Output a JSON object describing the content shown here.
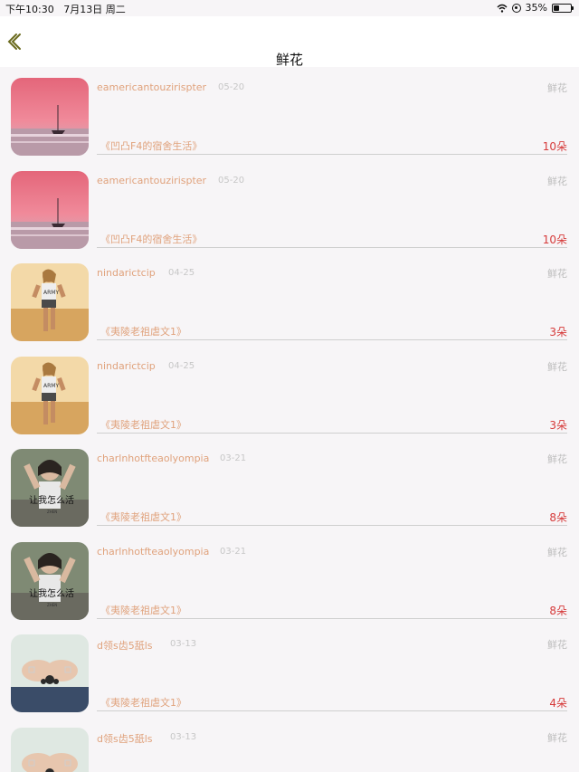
{
  "status_bar": {
    "time": "下午10:30",
    "date": "7月13日 周二",
    "battery": "35%",
    "battery_level": 0.35
  },
  "nav": {
    "title": "鲜花",
    "back_icon": "chevron-left-icon"
  },
  "colors": {
    "accent": "#e0a27c",
    "count": "#d63a3a",
    "muted": "#bdbdbd",
    "background": "#f7f5f7"
  },
  "rows": [
    {
      "avatar": "sunset-sailboat-image",
      "username": "eamericantouzirispter",
      "date": "05-20",
      "category": "鲜花",
      "book": "《凹凸F4的宿舍生活》",
      "count": "10朵"
    },
    {
      "avatar": "sunset-sailboat-image",
      "username": "eamericantouzirispter",
      "date": "05-20",
      "category": "鲜花",
      "book": "《凹凸F4的宿舍生活》",
      "count": "10朵"
    },
    {
      "avatar": "runner-beach-image",
      "username": "nindarictcip",
      "date": "04-25",
      "category": "鲜花",
      "book": "《夷陵老祖虐文1》",
      "count": "3朵"
    },
    {
      "avatar": "runner-beach-image",
      "username": "nindarictcip",
      "date": "04-25",
      "category": "鲜花",
      "book": "《夷陵老祖虐文1》",
      "count": "3朵"
    },
    {
      "avatar": "girl-poster-image",
      "username": "charlnhotfteaolyompia",
      "date": "03-21",
      "category": "鲜花",
      "book": "《夷陵老祖虐文1》",
      "count": "8朵"
    },
    {
      "avatar": "girl-poster-image",
      "username": "charlnhotfteaolyompia",
      "date": "03-21",
      "category": "鲜花",
      "book": "《夷陵老祖虐文1》",
      "count": "8朵"
    },
    {
      "avatar": "hands-rings-image",
      "username": "d领s齿5舐ls",
      "date": "03-13",
      "category": "鲜花",
      "book": "《夷陵老祖虐文1》",
      "count": "4朵"
    },
    {
      "avatar": "hands-rings-image",
      "username": "d领s齿5舐ls",
      "date": "03-13",
      "category": "鲜花",
      "book": "",
      "count": ""
    }
  ]
}
